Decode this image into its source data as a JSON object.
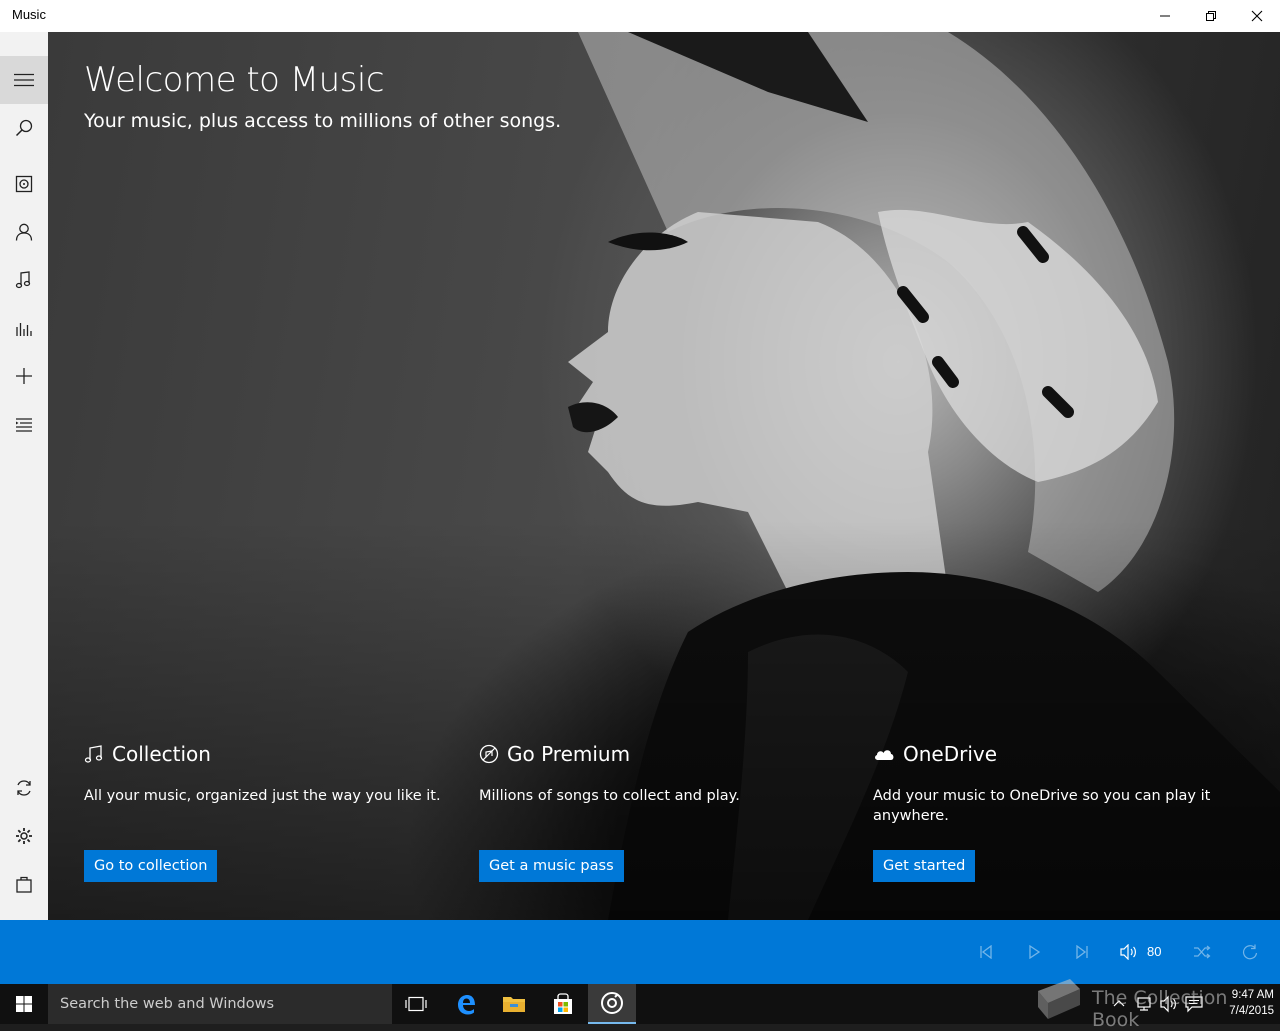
{
  "window": {
    "title": "Music",
    "controls": [
      "minimize-icon",
      "restore-icon",
      "close-icon"
    ]
  },
  "nav_rail": {
    "items": [
      {
        "icon": "hamburger-menu-icon",
        "selected": true
      },
      {
        "icon": "search-icon"
      },
      {
        "icon": "albums-icon"
      },
      {
        "icon": "artists-icon"
      },
      {
        "icon": "songs-icon"
      },
      {
        "icon": "now-playing-icon"
      },
      {
        "icon": "new-playlist-icon"
      },
      {
        "icon": "playlists-icon"
      }
    ],
    "bottom_items": [
      {
        "icon": "sync-icon"
      },
      {
        "icon": "settings-icon"
      },
      {
        "icon": "store-icon"
      }
    ]
  },
  "hero": {
    "title": "Welcome to Music",
    "subtitle": "Your music, plus access to millions of other songs."
  },
  "cards": [
    {
      "icon": "music-note-icon",
      "title": "Collection",
      "description": "All your music, organized just the way you like it.",
      "button": "Go to collection"
    },
    {
      "icon": "premium-icon",
      "title": "Go Premium",
      "description": "Millions of songs to collect and play.",
      "button": "Get a music pass"
    },
    {
      "icon": "cloud-icon",
      "title": "OneDrive",
      "description": "Add your music to OneDrive so you can play it anywhere.",
      "button": "Get started"
    }
  ],
  "player": {
    "controls": [
      "previous-icon",
      "play-icon",
      "next-icon",
      "volume-icon",
      "shuffle-icon",
      "repeat-icon"
    ],
    "volume": "80",
    "accent": "#0078d7"
  },
  "taskbar": {
    "search_placeholder": "Search the web and Windows",
    "time": "9:47 AM",
    "date": "7/4/2015",
    "apps": [
      "task-view-icon",
      "edge-icon",
      "file-explorer-icon",
      "store-icon",
      "groove-music-icon"
    ]
  },
  "watermark": {
    "text": "The Collection Book"
  }
}
